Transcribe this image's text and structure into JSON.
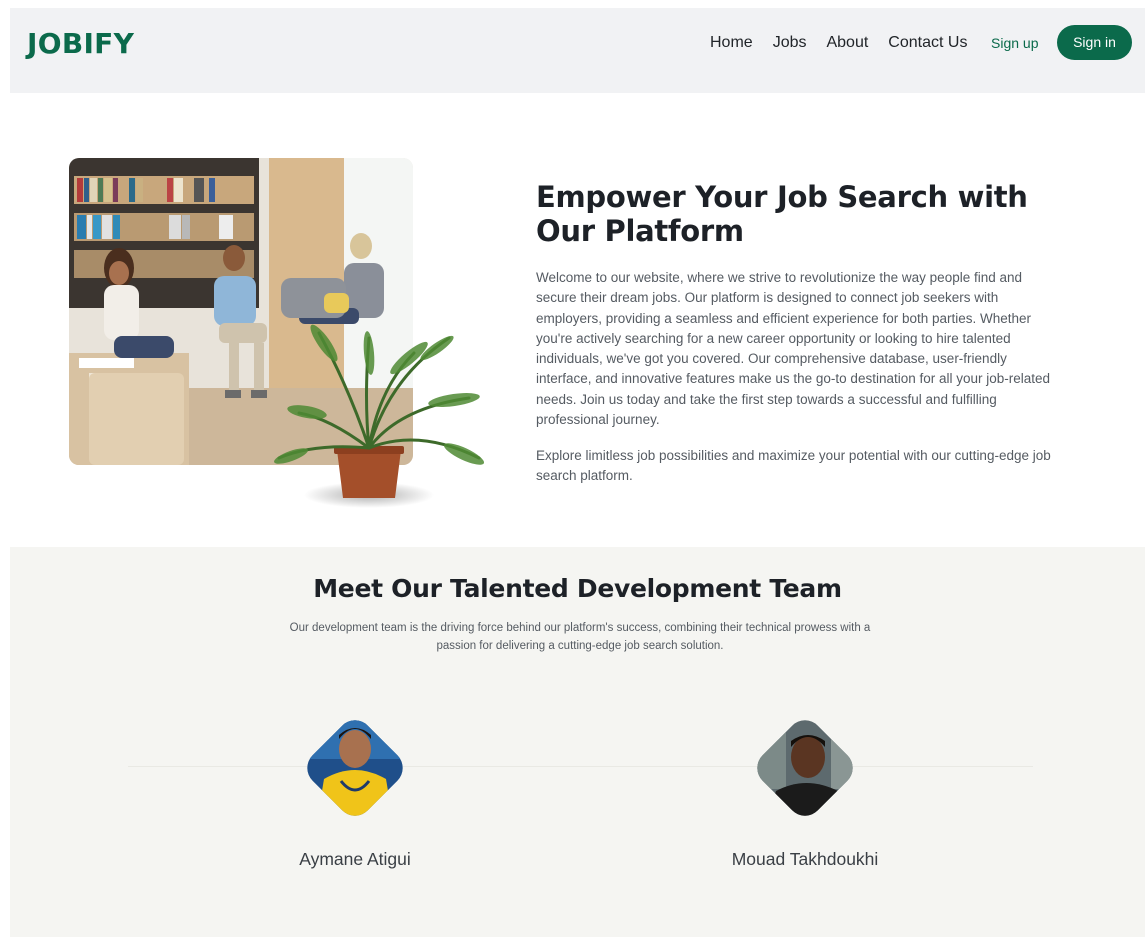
{
  "colors": {
    "brand": "#0b6a4b",
    "accent": "#0b6a4b",
    "nav_bg": "#f1f2f4",
    "team_bg": "#f5f5f2"
  },
  "navbar": {
    "brand": "JOBIFY",
    "links": [
      "Home",
      "Jobs",
      "About",
      "Contact Us"
    ],
    "signup_label": "Sign up",
    "signin_label": "Sign in"
  },
  "hero": {
    "image_alt": "office-team-photo",
    "title": "Empower Your Job Search with Our Platform",
    "paragraph_1": "Welcome to our website, where we strive to revolutionize the way people find and secure their dream jobs. Our platform is designed to connect job seekers with employers, providing a seamless and efficient experience for both parties. Whether you're actively searching for a new career opportunity or looking to hire talented individuals, we've got you covered. Our comprehensive database, user-friendly interface, and innovative features make us the go-to destination for all your job-related needs. Join us today and take the first step towards a successful and fulfilling professional journey.",
    "paragraph_2": "Explore limitless job possibilities and maximize your potential with our cutting-edge job search platform."
  },
  "team": {
    "title": "Meet Our Talented Development Team",
    "subtitle": "Our development team is the driving force behind our platform's success, combining their technical prowess with a passion for delivering a cutting-edge job search solution.",
    "members": [
      {
        "name": "Aymane Atigui"
      },
      {
        "name": "Mouad Takhdoukhi"
      }
    ]
  }
}
